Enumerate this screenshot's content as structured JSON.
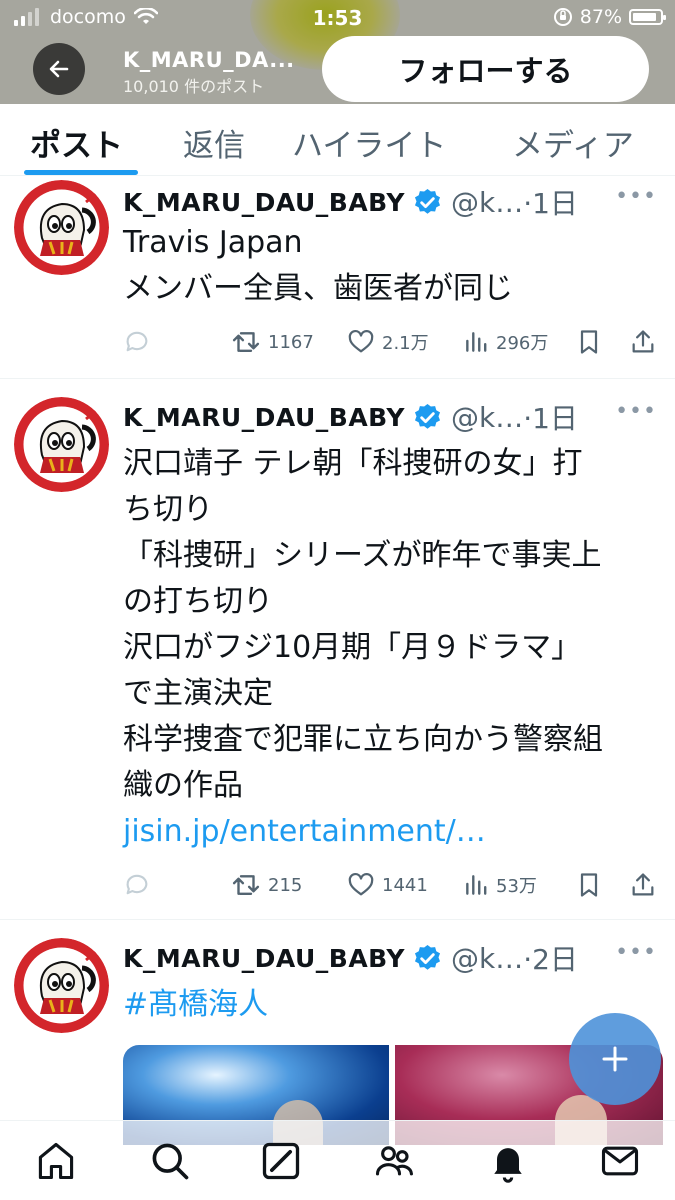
{
  "status_bar": {
    "carrier": "docomo",
    "time": "1:53",
    "battery": "87%",
    "battery_level": 0.87
  },
  "header": {
    "profile_name": "K_MARU_DA...",
    "post_count": "10,010 件のポスト",
    "follow_label": "フォローする"
  },
  "tabs": [
    {
      "label": "ポスト",
      "active": true
    },
    {
      "label": "返信",
      "active": false
    },
    {
      "label": "ハイライト",
      "active": false
    },
    {
      "label": "メディア",
      "active": false
    }
  ],
  "tweets": [
    {
      "name": "K_MARU_DAU_BABY",
      "handle": "@k…",
      "time": "·1日",
      "lines": [
        "Travis Japan",
        "メンバー全員、歯医者が同じ"
      ],
      "link": "",
      "retweets": "1167",
      "likes": "2.1万",
      "views": "296万"
    },
    {
      "name": "K_MARU_DAU_BABY",
      "handle": "@k…",
      "time": "·1日",
      "lines": [
        "沢口靖子 テレ朝「科捜研の女」打",
        "ち切り",
        "「科捜研」シリーズが昨年で事実上",
        "の打ち切り",
        "沢口がフジ10月期「月９ドラマ」",
        "で主演決定",
        "科学捜査で犯罪に立ち向かう警察組",
        "織の作品"
      ],
      "link": "jisin.jp/entertainment/…",
      "retweets": "215",
      "likes": "1441",
      "views": "53万"
    },
    {
      "name": "K_MARU_DAU_BABY",
      "handle": "@k…",
      "time": "·2日",
      "hashtag": "#髙橋海人"
    }
  ],
  "colors": {
    "accent": "#1d9bf0",
    "header_bg": "#a6a69e",
    "text_secondary": "#536471"
  },
  "icons": [
    "back-arrow-icon",
    "verified-badge-icon",
    "reply-icon",
    "retweet-icon",
    "like-icon",
    "views-icon",
    "bookmark-icon",
    "share-icon",
    "compose-plus-icon",
    "home-icon",
    "search-icon",
    "grok-icon",
    "communities-icon",
    "notifications-icon",
    "messages-icon"
  ]
}
